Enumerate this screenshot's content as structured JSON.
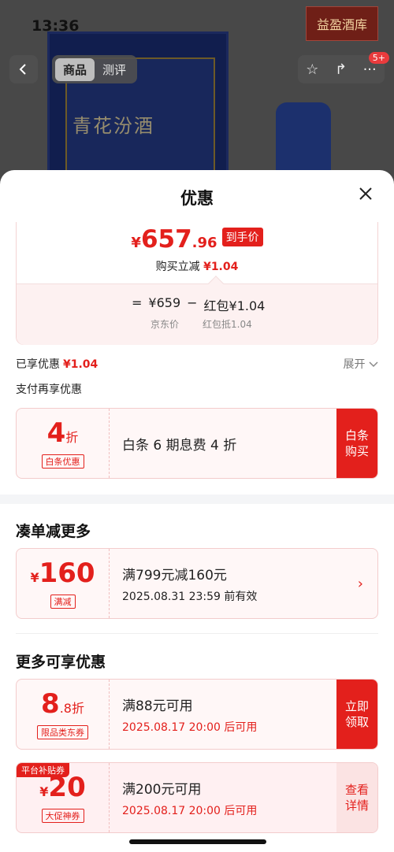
{
  "status": {
    "time": "13:36"
  },
  "header": {
    "store_badge": "益盈酒库",
    "tabs": [
      {
        "label": "商品",
        "active": true
      },
      {
        "label": "测评",
        "active": false
      }
    ],
    "message_badge": "5+",
    "product_text": "青花汾酒"
  },
  "sheet": {
    "title": "优惠",
    "price": {
      "currency": "¥",
      "integer": "657",
      "decimal": ".96",
      "final_tag": "到手价",
      "reduce_label": "购买立减",
      "reduce_amount": "¥1.04",
      "formula_eq": "=",
      "formula_jd": "¥659",
      "formula_minus": "−",
      "formula_hb": "红包¥1.04",
      "jd_caption": "京东价",
      "hb_caption": "红包抵1.04"
    },
    "enjoyed_label": "已享优惠",
    "enjoyed_amount": "¥1.04",
    "expand_label": "展开",
    "pay_more_label": "支付再享优惠",
    "baitiao": {
      "value": "4",
      "unit": "折",
      "tag": "白条优惠",
      "text": "白条 6 期息费 4 折",
      "action": "白条购买"
    },
    "section_more_order": "凑单减更多",
    "manjian": {
      "currency": "¥",
      "value": "160",
      "tag": "满减",
      "text": "满799元减160元",
      "valid": "2025.08.31 23:59 前有效"
    },
    "section_more_offers": "更多可享优惠",
    "coupon1": {
      "value": "8",
      "decimal": ".8",
      "unit": "折",
      "tag": "限品类东券",
      "text": "满88元可用",
      "valid": "2025.08.17 20:00 后可用",
      "action": "立即领取"
    },
    "coupon2": {
      "corner": "平台补贴券",
      "currency": "¥",
      "value": "20",
      "tag": "大促神券",
      "text": "满200元可用",
      "valid": "2025.08.17 20:00 后可用",
      "action": "查看详情"
    }
  }
}
